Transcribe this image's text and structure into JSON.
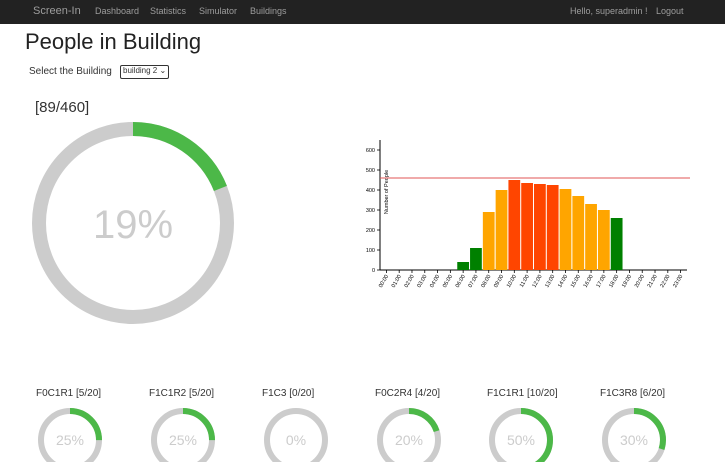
{
  "nav": {
    "brand": "Screen-In",
    "links": [
      "Dashboard",
      "Statistics",
      "Simulator",
      "Buildings"
    ],
    "greeting": "Hello, superadmin !",
    "logout": "Logout"
  },
  "page_title": "People in Building",
  "building_select": {
    "label": "Select the Building",
    "value": "building 2"
  },
  "occupancy": {
    "count_text": "[89/460]",
    "percent_text": "19%",
    "fraction": 0.19
  },
  "colors": {
    "green": "#4cb848",
    "track": "#cccccc",
    "orange": "#ffa500",
    "red": "#ff4500",
    "dark_green": "#008000",
    "limit_line": "#e05555"
  },
  "rooms": [
    {
      "label": "F0C1R1 [5/20]",
      "percent_text": "25%",
      "fraction": 0.25
    },
    {
      "label": "F1C1R2 [5/20]",
      "percent_text": "25%",
      "fraction": 0.25
    },
    {
      "label": "F1C3 [0/20]",
      "percent_text": "0%",
      "fraction": 0.0
    },
    {
      "label": "F0C2R4 [4/20]",
      "percent_text": "20%",
      "fraction": 0.2
    },
    {
      "label": "F1C1R1 [10/20]",
      "percent_text": "50%",
      "fraction": 0.5
    },
    {
      "label": "F1C3R8 [6/20]",
      "percent_text": "30%",
      "fraction": 0.3
    }
  ],
  "chart_data": {
    "type": "bar",
    "ylabel": "Number of People",
    "ylim": [
      0,
      650
    ],
    "yticks": [
      0,
      100,
      200,
      300,
      400,
      500,
      600
    ],
    "limit_line": 460,
    "categories": [
      "00:00",
      "01:00",
      "02:00",
      "03:00",
      "04:00",
      "05:00",
      "06:00",
      "07:00",
      "08:00",
      "09:00",
      "10:00",
      "11:00",
      "12:00",
      "13:00",
      "14:00",
      "15:00",
      "16:00",
      "17:00",
      "18:00",
      "19:00",
      "20:00",
      "21:00",
      "22:00",
      "23:00"
    ],
    "values": [
      0,
      0,
      0,
      0,
      0,
      0,
      40,
      110,
      290,
      400,
      450,
      435,
      430,
      425,
      405,
      370,
      330,
      300,
      260,
      0,
      0,
      0,
      0,
      0
    ],
    "bar_colors": [
      "#008000",
      "#008000",
      "#008000",
      "#008000",
      "#008000",
      "#008000",
      "#008000",
      "#008000",
      "#ffa500",
      "#ffa500",
      "#ff4500",
      "#ff4500",
      "#ff4500",
      "#ff4500",
      "#ffa500",
      "#ffa500",
      "#ffa500",
      "#ffa500",
      "#008000",
      "#008000",
      "#008000",
      "#008000",
      "#008000",
      "#008000"
    ]
  }
}
